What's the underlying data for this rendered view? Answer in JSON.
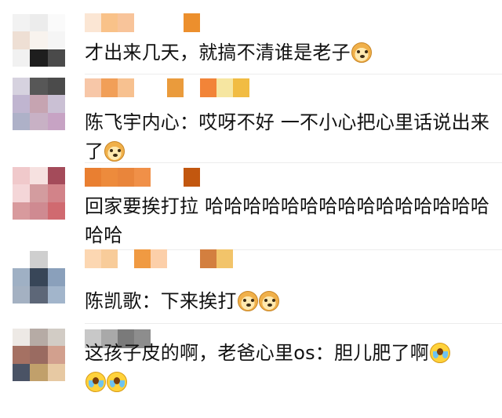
{
  "comments": [
    {
      "text": "才出来几天，就搞不清谁是老子",
      "emoji": [
        "doge-emoji"
      ],
      "avatar": [
        "#f2f2f2",
        "#ececec",
        "#fafafa",
        "#eedfd4",
        "#f8f3ee",
        "#f5f5f5",
        "#f1f1f1",
        "#1e1e1e",
        "#4a4a4a"
      ],
      "name_blocks": [
        "#fbe6d4",
        "#f9c289",
        "#f8c49a",
        "gap",
        "gap",
        "gap",
        "#ec8f2d"
      ]
    },
    {
      "text": "陈飞宇内心：哎呀不好 一不小心把心里话说出来了",
      "emoji": [
        "doge-emoji"
      ],
      "avatar": [
        "#d6d2df",
        "#575757",
        "#4b4b4b",
        "#c0b5d0",
        "#c6a4b1",
        "#cac0d4",
        "#aeb1c8",
        "#c8b1c5",
        "#c7a3c4"
      ],
      "name_blocks": [
        "#f7c7a8",
        "#f19f58",
        "#f7c190",
        "gap",
        "gap",
        "#ea9b3c",
        "gap",
        "#f28438",
        "#f6e6a1",
        "#f1bc43"
      ]
    },
    {
      "text": "回家要挨打拉 哈哈哈哈哈哈哈哈哈哈哈哈哈哈哈哈哈",
      "emoji": [],
      "avatar": [
        "#f0c9cb",
        "#f6e1e0",
        "#a44b5a",
        "#f4d6d8",
        "#d39c9f",
        "#d28389",
        "#d89a9d",
        "#cf8a91",
        "#d06a70"
      ],
      "name_blocks": [
        "#e97f31",
        "#ed8b3c",
        "#e9853b",
        "#f09048",
        "gap",
        "gap",
        "#c2570f"
      ]
    },
    {
      "text": "陈凯歌：下来挨打",
      "emoji": [
        "doge-emoji",
        "doge-emoji"
      ],
      "avatar": [
        "#ffffff",
        "#cfcfcf",
        "#ffffff",
        "#9fb0c4",
        "#384658",
        "#8aa0bb",
        "#a4b1c2",
        "#5d6778",
        "#a2b5cb"
      ],
      "name_blocks": [
        "#fcd7b2",
        "#f8cc9a",
        "gap",
        "#f09a42",
        "#fccfa9",
        "gap",
        "gap",
        "#d37f3f",
        "#f2c46a"
      ]
    },
    {
      "text": "这孩子皮的啊，老爸心里os：胆儿肥了啊",
      "emoji": [
        "cry-emoji",
        "cry-emoji",
        "cry-emoji"
      ],
      "avatar": [
        "#ede9e5",
        "#b6aba5",
        "#d2ccc5",
        "#a57163",
        "#9a6b61",
        "#d2a08e",
        "#4a5365",
        "#c1a06b",
        "#e7c9a3"
      ],
      "name_blocks": [
        "#c8c8c8",
        "#a9a9a9",
        "#7a7a7a",
        "#8d8d8d"
      ]
    }
  ]
}
